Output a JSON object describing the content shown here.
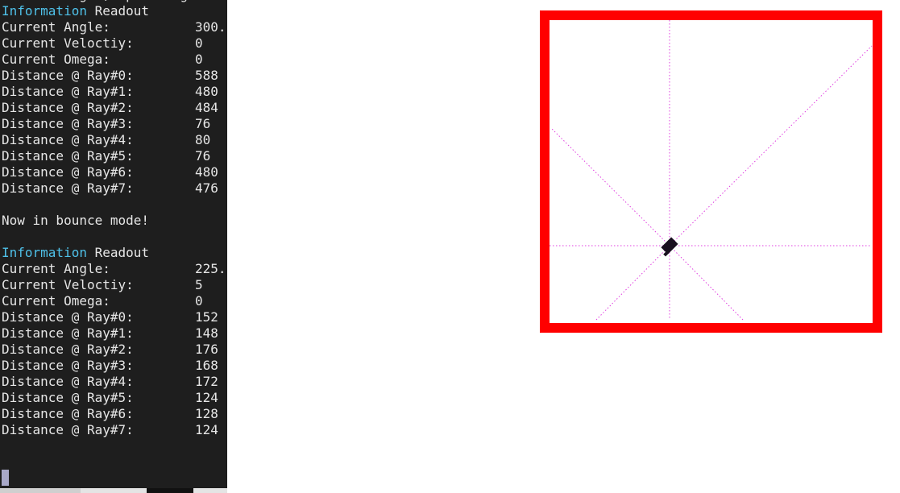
{
  "terminal": {
    "lines": [
      {
        "label": "Current Angle, Speed Angle",
        "value": ""
      },
      {
        "label_accent": "Information",
        "label_rest": " Readout",
        "value": ""
      },
      {
        "label": "Current Angle:",
        "value": "300."
      },
      {
        "label": "Current Veloctiy:",
        "value": "0"
      },
      {
        "label": "Current Omega:",
        "value": "0"
      },
      {
        "label": "Distance @ Ray#0:",
        "value": "588"
      },
      {
        "label": "Distance @ Ray#1:",
        "value": "480"
      },
      {
        "label": "Distance @ Ray#2:",
        "value": "484"
      },
      {
        "label": "Distance @ Ray#3:",
        "value": "76"
      },
      {
        "label": "Distance @ Ray#4:",
        "value": "80"
      },
      {
        "label": "Distance @ Ray#5:",
        "value": "76"
      },
      {
        "label": "Distance @ Ray#6:",
        "value": "480"
      },
      {
        "label": "Distance @ Ray#7:",
        "value": "476"
      },
      {
        "label": "",
        "value": ""
      },
      {
        "label": "Now in bounce mode!",
        "value": ""
      },
      {
        "label": "",
        "value": ""
      },
      {
        "label_accent": "Information",
        "label_rest": " Readout",
        "value": ""
      },
      {
        "label": "Current Angle:",
        "value": "225."
      },
      {
        "label": "Current Veloctiy:",
        "value": "5"
      },
      {
        "label": "Current Omega:",
        "value": "0"
      },
      {
        "label": "Distance @ Ray#0:",
        "value": "152"
      },
      {
        "label": "Distance @ Ray#1:",
        "value": "148"
      },
      {
        "label": "Distance @ Ray#2:",
        "value": "176"
      },
      {
        "label": "Distance @ Ray#3:",
        "value": "168"
      },
      {
        "label": "Distance @ Ray#4:",
        "value": "172"
      },
      {
        "label": "Distance @ Ray#5:",
        "value": "124"
      },
      {
        "label": "Distance @ Ray#6:",
        "value": "128"
      },
      {
        "label": "Distance @ Ray#7:",
        "value": "124"
      }
    ]
  },
  "colors": {
    "terminal_bg": "#1e1e1e",
    "terminal_text": "#e6e6e6",
    "accent": "#4fc1e9",
    "cursor": "#a8a8c8",
    "wall": "#ff0000",
    "ray": "#e040e0",
    "robot": "#1a1020"
  },
  "simulation": {
    "robot_angle_deg": 225,
    "ray_count": 8
  }
}
